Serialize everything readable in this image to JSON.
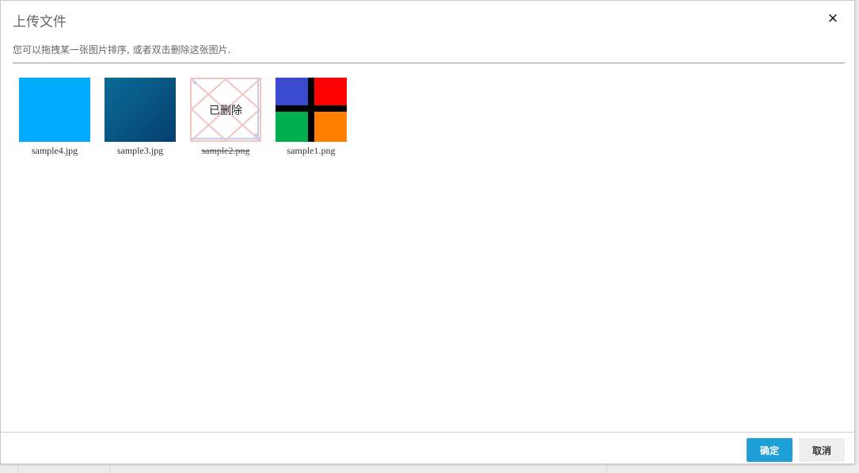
{
  "dialog": {
    "title": "上传文件",
    "hint": "您可以拖拽某一张图片排序, 或者双击删除这张图片."
  },
  "images": [
    {
      "name": "sample4.jpg",
      "deleted": false
    },
    {
      "name": "sample3.jpg",
      "deleted": false
    },
    {
      "name": "sample2.png",
      "deleted": true,
      "deleted_label": "已删除"
    },
    {
      "name": "sample1.png",
      "deleted": false
    }
  ],
  "footer": {
    "ok_label": "确定",
    "cancel_label": "取消"
  },
  "colors": {
    "ok_button": "#1e9fd8",
    "deleted_border": "#f2c4c4"
  },
  "icons": {
    "close": "close-icon"
  }
}
